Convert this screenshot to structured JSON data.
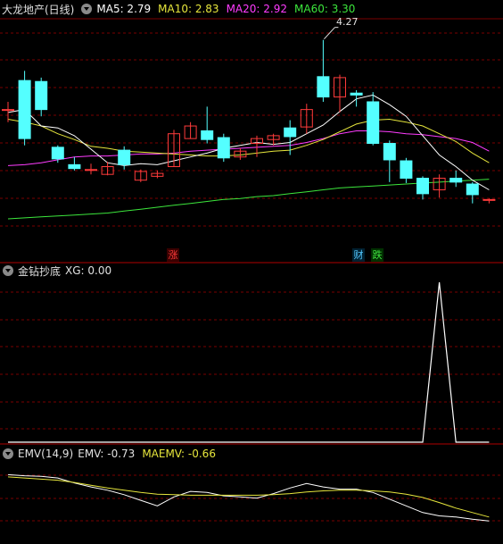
{
  "panel_main": {
    "title": "大龙地产(日线)",
    "ma5_label": "MA5: 2.79",
    "ma10_label": "MA10: 2.83",
    "ma20_label": "MA20: 2.92",
    "ma60_label": "MA60: 3.30",
    "max_price_label": "4.27",
    "signals": [
      {
        "text": "涨",
        "color": "#ff3b3b",
        "bg": "#3a0000"
      },
      {
        "text": "财",
        "color": "#54c8ff",
        "bg": "#002030"
      },
      {
        "text": "跌",
        "color": "#40e040",
        "bg": "#003000"
      }
    ]
  },
  "panel_xg": {
    "title": "金钻抄底",
    "value_label": "XG: 0.00"
  },
  "panel_emv": {
    "title": "EMV(14,9)",
    "emv_label": "EMV: -0.73",
    "maemv_label": "MAEMV: -0.66"
  },
  "colors": {
    "up": "#ff3b3b",
    "down": "#54ffff",
    "ma5": "#ffffff",
    "ma10": "#e6e63c",
    "ma20": "#ff3cff",
    "ma60": "#3ce63c",
    "grid": "#7a0000",
    "axis": "#b00000"
  },
  "chart_data": [
    {
      "type": "candlestick",
      "title": "大龙地产(日线)",
      "ylim": [
        2.3,
        4.35
      ],
      "max_label": 4.27,
      "candles": [
        {
          "o": 3.55,
          "c": 3.55,
          "h": 3.63,
          "l": 3.42
        },
        {
          "o": 3.85,
          "c": 3.25,
          "h": 3.95,
          "l": 3.18
        },
        {
          "o": 3.84,
          "c": 3.55,
          "h": 3.88,
          "l": 3.48
        },
        {
          "o": 3.16,
          "c": 3.04,
          "h": 3.18,
          "l": 3.0
        },
        {
          "o": 2.98,
          "c": 2.94,
          "h": 3.06,
          "l": 2.92
        },
        {
          "o": 2.93,
          "c": 2.93,
          "h": 2.99,
          "l": 2.88
        },
        {
          "o": 2.88,
          "c": 2.96,
          "h": 3.01,
          "l": 2.87
        },
        {
          "o": 3.13,
          "c": 2.98,
          "h": 3.17,
          "l": 2.93
        },
        {
          "o": 2.82,
          "c": 2.91,
          "h": 2.93,
          "l": 2.8
        },
        {
          "o": 2.86,
          "c": 2.89,
          "h": 2.92,
          "l": 2.84
        },
        {
          "o": 2.96,
          "c": 3.3,
          "h": 3.34,
          "l": 2.96
        },
        {
          "o": 3.25,
          "c": 3.38,
          "h": 3.42,
          "l": 3.25
        },
        {
          "o": 3.33,
          "c": 3.24,
          "h": 3.58,
          "l": 3.2
        },
        {
          "o": 3.26,
          "c": 3.05,
          "h": 3.3,
          "l": 3.01
        },
        {
          "o": 3.06,
          "c": 3.12,
          "h": 3.15,
          "l": 3.03
        },
        {
          "o": 3.2,
          "c": 3.25,
          "h": 3.28,
          "l": 3.06
        },
        {
          "o": 3.24,
          "c": 3.28,
          "h": 3.3,
          "l": 3.18
        },
        {
          "o": 3.36,
          "c": 3.27,
          "h": 3.44,
          "l": 3.08
        },
        {
          "o": 3.37,
          "c": 3.55,
          "h": 3.61,
          "l": 3.3
        },
        {
          "o": 3.89,
          "c": 3.68,
          "h": 4.27,
          "l": 3.63
        },
        {
          "o": 3.68,
          "c": 3.88,
          "h": 3.91,
          "l": 3.52
        },
        {
          "o": 3.72,
          "c": 3.7,
          "h": 3.75,
          "l": 3.58
        },
        {
          "o": 3.63,
          "c": 3.2,
          "h": 3.73,
          "l": 3.18
        },
        {
          "o": 3.2,
          "c": 3.03,
          "h": 3.23,
          "l": 2.8
        },
        {
          "o": 3.02,
          "c": 2.84,
          "h": 3.05,
          "l": 2.79
        },
        {
          "o": 2.84,
          "c": 2.68,
          "h": 2.86,
          "l": 2.62
        },
        {
          "o": 2.72,
          "c": 2.84,
          "h": 2.88,
          "l": 2.64
        },
        {
          "o": 2.84,
          "c": 2.8,
          "h": 2.92,
          "l": 2.75
        },
        {
          "o": 2.78,
          "c": 2.67,
          "h": 2.8,
          "l": 2.58
        },
        {
          "o": 2.62,
          "c": 2.62,
          "h": 2.63,
          "l": 2.58
        }
      ],
      "series": [
        {
          "name": "MA5",
          "values": [
            3.52,
            3.55,
            3.38,
            3.36,
            3.28,
            3.14,
            3.0,
            2.97,
            2.99,
            2.98,
            3.02,
            3.06,
            3.1,
            3.15,
            3.18,
            3.21,
            3.19,
            3.21,
            3.3,
            3.39,
            3.53,
            3.66,
            3.7,
            3.6,
            3.48,
            3.28,
            3.08,
            2.96,
            2.82,
            2.72
          ]
        },
        {
          "name": "MA10",
          "values": [
            3.45,
            3.42,
            3.38,
            3.3,
            3.24,
            3.17,
            3.15,
            3.12,
            3.11,
            3.1,
            3.09,
            3.08,
            3.07,
            3.07,
            3.08,
            3.1,
            3.12,
            3.13,
            3.18,
            3.24,
            3.32,
            3.4,
            3.44,
            3.45,
            3.42,
            3.38,
            3.3,
            3.22,
            3.1,
            3.0
          ]
        },
        {
          "name": "MA20",
          "values": [
            2.97,
            2.98,
            3.0,
            3.03,
            3.06,
            3.07,
            3.07,
            3.08,
            3.09,
            3.09,
            3.1,
            3.12,
            3.13,
            3.14,
            3.15,
            3.16,
            3.17,
            3.18,
            3.21,
            3.25,
            3.3,
            3.33,
            3.33,
            3.32,
            3.3,
            3.29,
            3.27,
            3.25,
            3.21,
            3.12
          ]
        },
        {
          "name": "MA60",
          "values": [
            2.42,
            2.43,
            2.44,
            2.45,
            2.46,
            2.47,
            2.48,
            2.5,
            2.52,
            2.54,
            2.56,
            2.58,
            2.6,
            2.62,
            2.63,
            2.65,
            2.66,
            2.68,
            2.7,
            2.72,
            2.74,
            2.75,
            2.76,
            2.77,
            2.78,
            2.79,
            2.8,
            2.81,
            2.82,
            2.83
          ]
        }
      ]
    },
    {
      "type": "line",
      "title": "金钻抄底",
      "ylim": [
        0,
        1
      ],
      "series": [
        {
          "name": "XG",
          "values": [
            0,
            0,
            0,
            0,
            0,
            0,
            0,
            0,
            0,
            0,
            0,
            0,
            0,
            0,
            0,
            0,
            0,
            0,
            0,
            0,
            0,
            0,
            0,
            0,
            0,
            0,
            1,
            0,
            0,
            0
          ]
        }
      ]
    },
    {
      "type": "line",
      "title": "EMV(14,9)",
      "ylim": [
        -1.0,
        0.25
      ],
      "series": [
        {
          "name": "EMV",
          "values": [
            0.1,
            0.08,
            0.07,
            0.04,
            -0.05,
            -0.12,
            -0.18,
            -0.26,
            -0.36,
            -0.46,
            -0.3,
            -0.2,
            -0.22,
            -0.28,
            -0.3,
            -0.32,
            -0.24,
            -0.14,
            -0.06,
            -0.12,
            -0.16,
            -0.16,
            -0.22,
            -0.34,
            -0.46,
            -0.58,
            -0.64,
            -0.66,
            -0.7,
            -0.73
          ]
        },
        {
          "name": "MAEMV",
          "values": [
            0.06,
            0.04,
            0.02,
            0.0,
            -0.04,
            -0.09,
            -0.14,
            -0.18,
            -0.22,
            -0.25,
            -0.26,
            -0.27,
            -0.27,
            -0.27,
            -0.27,
            -0.27,
            -0.26,
            -0.24,
            -0.21,
            -0.19,
            -0.18,
            -0.18,
            -0.19,
            -0.21,
            -0.25,
            -0.31,
            -0.4,
            -0.5,
            -0.58,
            -0.66
          ]
        }
      ]
    }
  ]
}
